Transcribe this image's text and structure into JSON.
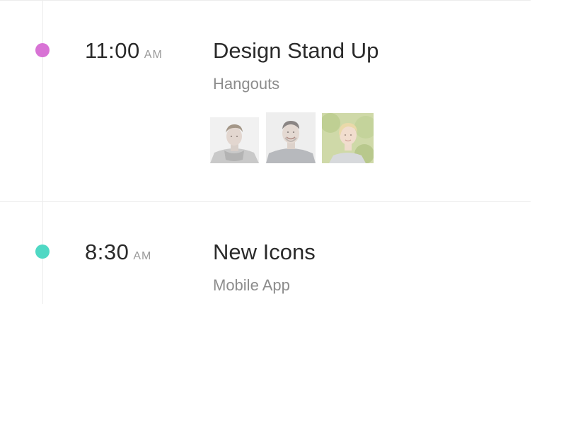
{
  "events": [
    {
      "time": "11:00",
      "period": "AM",
      "title": "Design Stand Up",
      "location": "Hangouts",
      "dot_color": "#d873d5",
      "attendees": [
        {
          "icon": "avatar-man-photo"
        },
        {
          "icon": "avatar-smiling-man-photo"
        },
        {
          "icon": "avatar-woman-photo"
        }
      ]
    },
    {
      "time": "8:30",
      "period": "AM",
      "title": "New Icons",
      "location": "Mobile App",
      "dot_color": "#4fd8c4",
      "attendees": []
    }
  ]
}
